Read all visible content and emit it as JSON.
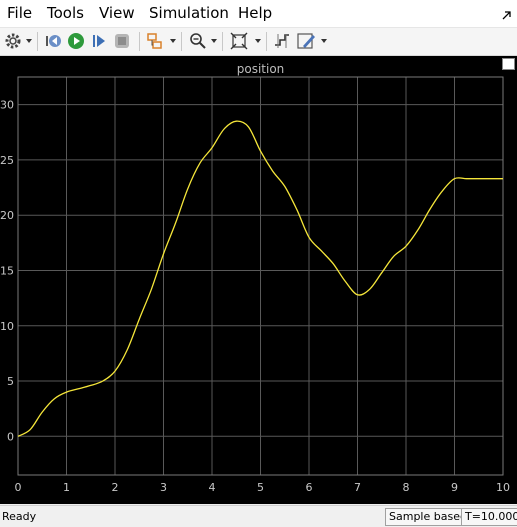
{
  "menu": [
    "File",
    "Tools",
    "View",
    "Simulation",
    "Help"
  ],
  "toolbar": {
    "icons": [
      "settings-icon",
      "step-back-icon",
      "run-icon",
      "step-forward-icon",
      "stop-icon",
      "highlight-block-icon",
      "zoom-icon",
      "fit-to-view-icon",
      "cursor-measurement-icon",
      "style-icon"
    ]
  },
  "status": {
    "state": "Ready",
    "mode": "Sample based",
    "time": "T=10.000"
  },
  "colors": {
    "background": "#000000",
    "grid": "#595959",
    "line": "#f5e63a",
    "text": "#c8c8c8"
  },
  "chart_data": {
    "type": "line",
    "title": "position",
    "xlabel": "",
    "ylabel": "",
    "xlim": [
      0,
      10
    ],
    "ylim": [
      -3.5,
      32.5
    ],
    "xticks": [
      0,
      1,
      2,
      3,
      4,
      5,
      6,
      7,
      8,
      9,
      10
    ],
    "yticks": [
      0,
      5,
      10,
      15,
      20,
      25,
      30
    ],
    "grid": true,
    "series": [
      {
        "x": [
          0,
          0.25,
          0.5,
          0.75,
          1.0,
          1.25,
          1.5,
          1.75,
          2.0,
          2.25,
          2.5,
          2.75,
          3.0,
          3.25,
          3.5,
          3.75,
          4.0,
          4.25,
          4.5,
          4.75,
          5.0,
          5.25,
          5.5,
          5.75,
          6.0,
          6.25,
          6.5,
          6.75,
          7.0,
          7.25,
          7.5,
          7.75,
          8.0,
          8.25,
          8.5,
          8.75,
          9.0,
          9.25,
          9.5,
          9.75,
          10.0
        ],
        "values": [
          0,
          0.6,
          2.2,
          3.4,
          4.0,
          4.3,
          4.6,
          5.0,
          5.9,
          7.8,
          10.6,
          13.3,
          16.5,
          19.3,
          22.4,
          24.7,
          26.1,
          27.8,
          28.5,
          28.0,
          25.8,
          24.0,
          22.6,
          20.5,
          18.0,
          16.8,
          15.6,
          14.0,
          12.8,
          13.3,
          14.8,
          16.3,
          17.2,
          18.7,
          20.6,
          22.2,
          23.3,
          23.3,
          23.3,
          23.3,
          23.3
        ]
      }
    ]
  }
}
